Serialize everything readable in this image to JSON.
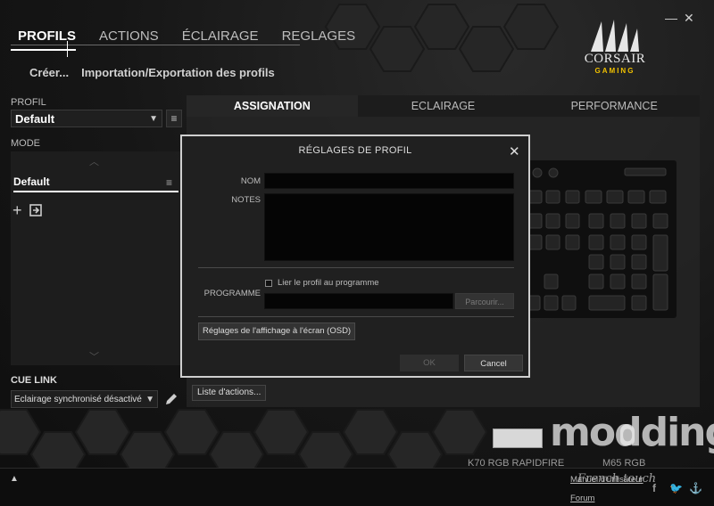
{
  "window": {
    "minimize_glyph": "—",
    "close_glyph": "✕"
  },
  "top_nav": {
    "tabs": [
      {
        "label": "PROFILS",
        "active": true
      },
      {
        "label": "ACTIONS",
        "active": false
      },
      {
        "label": "ÉCLAIRAGE",
        "active": false
      },
      {
        "label": "REGLAGES",
        "active": false
      }
    ]
  },
  "sub_nav": {
    "create": "Créer...",
    "import_export": "Importation/Exportation des profils"
  },
  "logo": {
    "brand": "CORSAIR",
    "sub": "GAMING"
  },
  "profile": {
    "label": "PROFIL",
    "value": "Default",
    "arrow": "▼",
    "menu_glyph": "≡"
  },
  "mode": {
    "label": "MODE",
    "item": "Default",
    "item_menu_glyph": "≡",
    "up_glyph": "︿",
    "down_glyph": "﹀",
    "add_glyph": "+"
  },
  "cue_link": {
    "label": "CUE LINK",
    "value": "Eclairage synchronisé désactivé",
    "arrow": "▼"
  },
  "main_tabs": [
    {
      "label": "ASSIGNATION",
      "active": true
    },
    {
      "label": "ECLAIRAGE",
      "active": false
    },
    {
      "label": "PERFORMANCE",
      "active": false
    }
  ],
  "actions_list_button": "Liste d'actions...",
  "modal": {
    "title": "RÉGLAGES DE PROFIL",
    "close_glyph": "✕",
    "name_label": "NOM",
    "name_value": "",
    "notes_label": "NOTES",
    "notes_value": "",
    "link_checkbox_label": "Lier le profil au programme",
    "link_checked": false,
    "program_label": "PROGRAMME",
    "program_value": "",
    "browse_button": "Parcourir...",
    "osd_button": "Réglages de l'affichage à l'écran (OSD)",
    "ok_button": "OK",
    "cancel_button": "Cancel"
  },
  "devices": [
    {
      "name": "K70 RGB RAPIDFIRE"
    },
    {
      "name": "M65 RGB"
    }
  ],
  "footer": {
    "manual_link": "Manuel d'utilisateur",
    "forum_link": "Forum"
  },
  "watermark": {
    "main": "modding.fr",
    "sub": "French touch"
  },
  "bottom": {
    "expand_glyph": "▲"
  },
  "social": {
    "facebook": "f",
    "twitter": "🐦",
    "corsair": "⚓"
  },
  "colors": {
    "logo_accent": "#f0c000",
    "background": "#151515"
  }
}
